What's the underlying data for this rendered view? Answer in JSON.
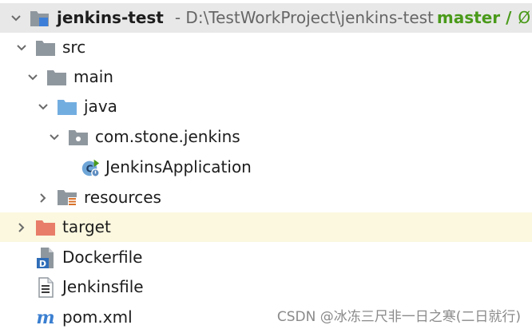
{
  "project": {
    "name": "jenkins-test",
    "path": "- D:\\TestWorkProject\\jenkins-test",
    "branch": "master /",
    "branch_extra": "Ø"
  },
  "tree": {
    "src": "src",
    "main": "main",
    "java": "java",
    "package": "com.stone.jenkins",
    "app_class": "JenkinsApplication",
    "resources": "resources",
    "target": "target",
    "dockerfile": "Dockerfile",
    "jenkinsfile": "Jenkinsfile",
    "pom": "pom.xml"
  },
  "icons": {
    "module": "module-folder-icon",
    "folder": "folder-icon",
    "source_root": "source-root-icon",
    "package": "package-icon",
    "spring_class": "spring-boot-class-icon",
    "resources": "resources-root-icon",
    "excluded": "excluded-folder-icon",
    "docker": "dockerfile-icon",
    "text_file": "text-file-icon",
    "maven": "maven-icon"
  },
  "colors": {
    "folder": "#8f979e",
    "source_root": "#72ade0",
    "excluded": "#e87d6a",
    "branch": "#4a9a1a",
    "selected_row": "#e8e8e8",
    "highlight_row": "#fbf8df",
    "maven": "#3a7fd1"
  },
  "watermark": "CSDN @冰冻三尺非一日之寒(二日就行)"
}
